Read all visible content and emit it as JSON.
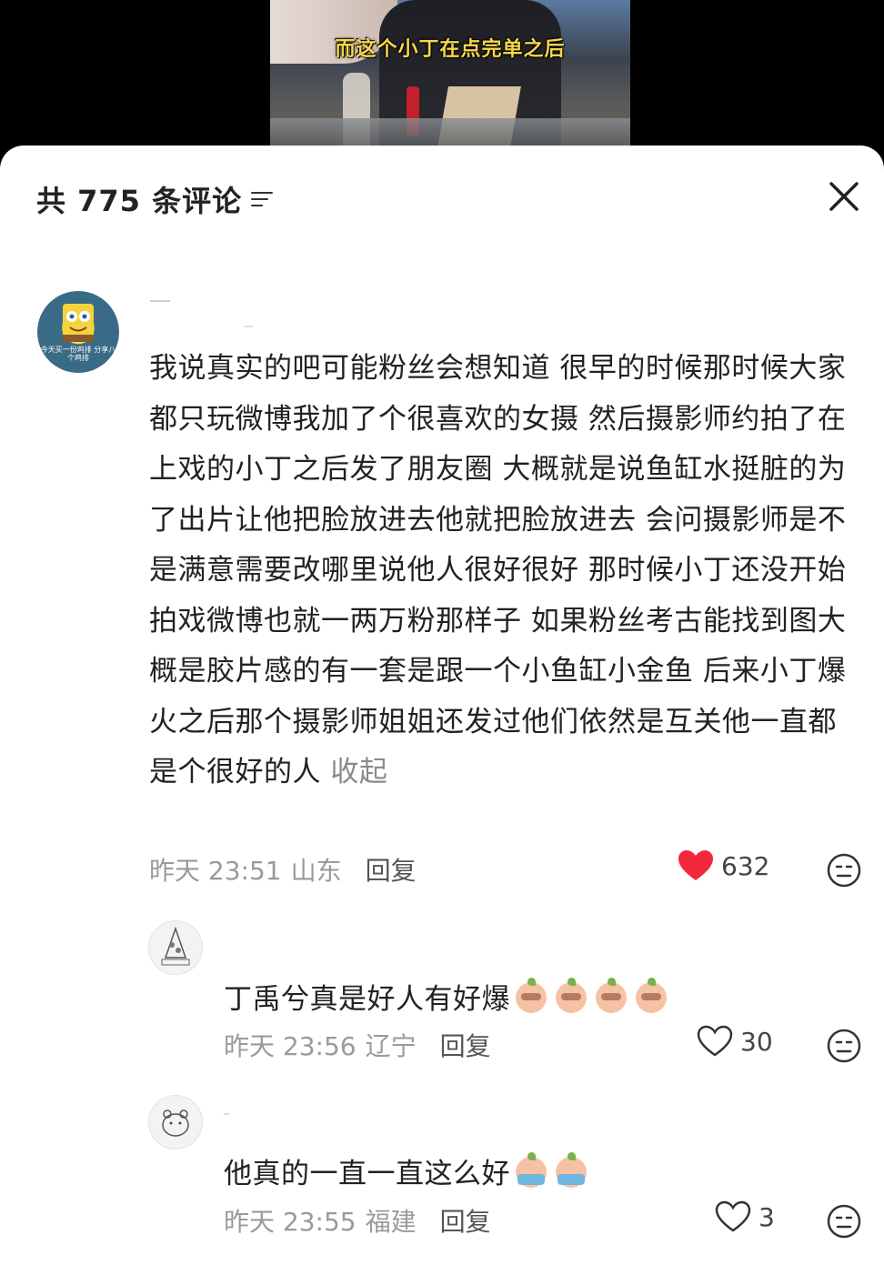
{
  "video": {
    "caption": "而这个小丁在点完单之后"
  },
  "header": {
    "title": "共 775 条评论",
    "filter_icon": "filter-icon",
    "close_icon": "close-icon"
  },
  "comments": [
    {
      "text": "我说真实的吧可能粉丝会想知道  很早的时候那时候大家都只玩微博我加了个很喜欢的女摄  然后摄影师约拍了在上戏的小丁之后发了朋友圈  大概就是说鱼缸水挺脏的为了出片让他把脸放进去他就把脸放进去  会问摄影师是不是满意需要改哪里说他人很好很好  那时候小丁还没开始拍戏微博也就一两万粉那样子  如果粉丝考古能找到图大概是胶片感的有一套是跟一个小鱼缸小金鱼  后来小丁爆火之后那个摄影师姐姐还发过他们依然是互关他一直都是个很好的人",
      "collapse": "收起",
      "time": "昨天 23:51",
      "location": "山东",
      "reply": "回复",
      "likes": "632",
      "liked": true,
      "avatar_text": "今天买一份鸡排\n分享八个鸡排"
    },
    {
      "text": "丁禹兮真是好人有好爆",
      "emoji_count": 4,
      "time": "昨天 23:56",
      "location": "辽宁",
      "reply": "回复",
      "likes": "30",
      "liked": false
    },
    {
      "text": "他真的一直一直这么好",
      "emoji_count": 2,
      "time": "昨天 23:55",
      "location": "福建",
      "reply": "回复",
      "likes": "3",
      "liked": false
    }
  ],
  "colors": {
    "like_red": "#f2293b",
    "meta_gray": "#9a9a9a"
  }
}
